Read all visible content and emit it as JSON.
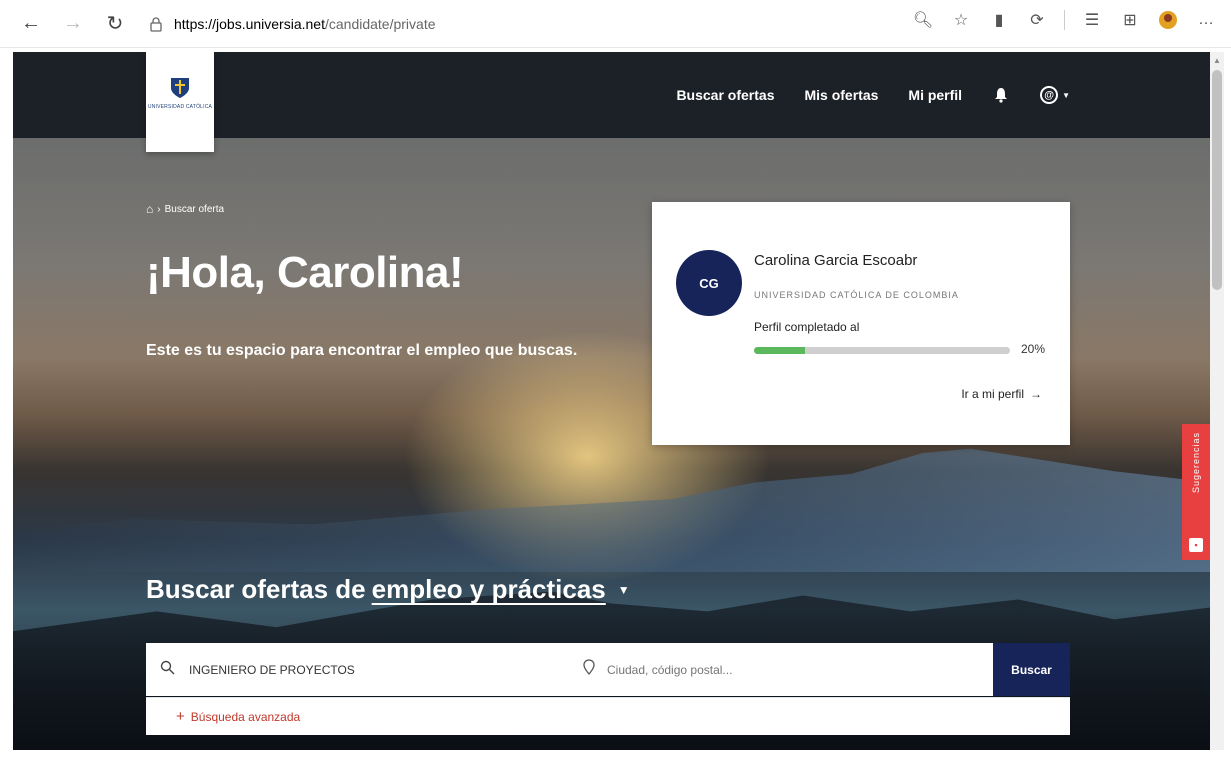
{
  "browser": {
    "url_host": "https://jobs.universia.net",
    "url_path": "/candidate/private"
  },
  "header": {
    "logo_alt": "UNIVERSIDAD CATÓLICA",
    "nav": {
      "search_offers": "Buscar ofertas",
      "my_offers": "Mis ofertas",
      "my_profile": "Mi perfil"
    }
  },
  "breadcrumb": {
    "separator": "›",
    "current": "Buscar oferta"
  },
  "hero": {
    "greeting": "¡Hola, Carolina!",
    "tagline": "Este es tu espacio para encontrar el empleo que buscas."
  },
  "profile_card": {
    "initials": "CG",
    "name": "Carolina Garcia Escoabr",
    "university": "UNIVERSIDAD CATÓLICA DE COLOMBIA",
    "progress_label": "Perfil completado al",
    "progress_value": 0.2,
    "progress_text": "20%",
    "profile_link": "Ir a mi perfil",
    "profile_link_arrow": "→"
  },
  "search": {
    "title_prefix": "Buscar ofertas de",
    "title_emphasis": "empleo y prácticas",
    "query_value": "INGENIERO DE PROYECTOS",
    "location_placeholder": "Ciudad, código postal...",
    "button_label": "Buscar",
    "advanced_label": "Búsqueda avanzada"
  },
  "feedback_tab": {
    "label": "Sugerencias"
  },
  "colors": {
    "header_bg": "#1c2128",
    "primary": "#16245a",
    "progress": "#5cb85c",
    "accent_red": "#e84040"
  }
}
